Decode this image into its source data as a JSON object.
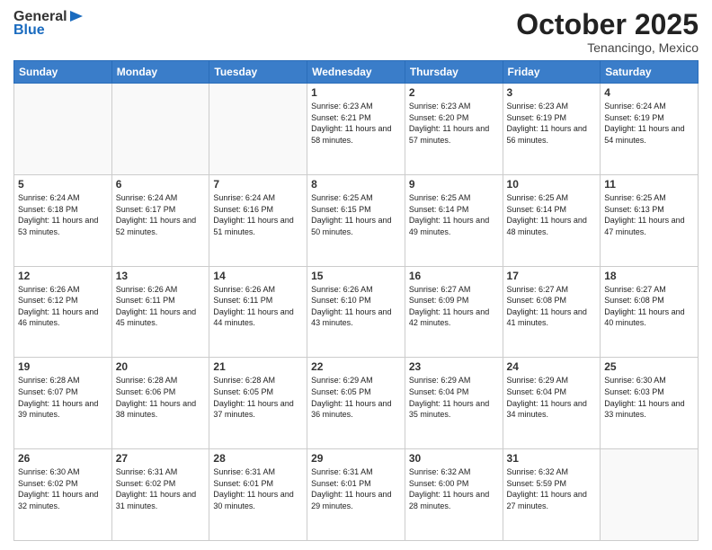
{
  "header": {
    "logo_general": "General",
    "logo_blue": "Blue",
    "month_title": "October 2025",
    "location": "Tenancingo, Mexico"
  },
  "days_of_week": [
    "Sunday",
    "Monday",
    "Tuesday",
    "Wednesday",
    "Thursday",
    "Friday",
    "Saturday"
  ],
  "weeks": [
    [
      {
        "day": "",
        "sunrise": "",
        "sunset": "",
        "daylight": ""
      },
      {
        "day": "",
        "sunrise": "",
        "sunset": "",
        "daylight": ""
      },
      {
        "day": "",
        "sunrise": "",
        "sunset": "",
        "daylight": ""
      },
      {
        "day": "1",
        "sunrise": "Sunrise: 6:23 AM",
        "sunset": "Sunset: 6:21 PM",
        "daylight": "Daylight: 11 hours and 58 minutes."
      },
      {
        "day": "2",
        "sunrise": "Sunrise: 6:23 AM",
        "sunset": "Sunset: 6:20 PM",
        "daylight": "Daylight: 11 hours and 57 minutes."
      },
      {
        "day": "3",
        "sunrise": "Sunrise: 6:23 AM",
        "sunset": "Sunset: 6:19 PM",
        "daylight": "Daylight: 11 hours and 56 minutes."
      },
      {
        "day": "4",
        "sunrise": "Sunrise: 6:24 AM",
        "sunset": "Sunset: 6:19 PM",
        "daylight": "Daylight: 11 hours and 54 minutes."
      }
    ],
    [
      {
        "day": "5",
        "sunrise": "Sunrise: 6:24 AM",
        "sunset": "Sunset: 6:18 PM",
        "daylight": "Daylight: 11 hours and 53 minutes."
      },
      {
        "day": "6",
        "sunrise": "Sunrise: 6:24 AM",
        "sunset": "Sunset: 6:17 PM",
        "daylight": "Daylight: 11 hours and 52 minutes."
      },
      {
        "day": "7",
        "sunrise": "Sunrise: 6:24 AM",
        "sunset": "Sunset: 6:16 PM",
        "daylight": "Daylight: 11 hours and 51 minutes."
      },
      {
        "day": "8",
        "sunrise": "Sunrise: 6:25 AM",
        "sunset": "Sunset: 6:15 PM",
        "daylight": "Daylight: 11 hours and 50 minutes."
      },
      {
        "day": "9",
        "sunrise": "Sunrise: 6:25 AM",
        "sunset": "Sunset: 6:14 PM",
        "daylight": "Daylight: 11 hours and 49 minutes."
      },
      {
        "day": "10",
        "sunrise": "Sunrise: 6:25 AM",
        "sunset": "Sunset: 6:14 PM",
        "daylight": "Daylight: 11 hours and 48 minutes."
      },
      {
        "day": "11",
        "sunrise": "Sunrise: 6:25 AM",
        "sunset": "Sunset: 6:13 PM",
        "daylight": "Daylight: 11 hours and 47 minutes."
      }
    ],
    [
      {
        "day": "12",
        "sunrise": "Sunrise: 6:26 AM",
        "sunset": "Sunset: 6:12 PM",
        "daylight": "Daylight: 11 hours and 46 minutes."
      },
      {
        "day": "13",
        "sunrise": "Sunrise: 6:26 AM",
        "sunset": "Sunset: 6:11 PM",
        "daylight": "Daylight: 11 hours and 45 minutes."
      },
      {
        "day": "14",
        "sunrise": "Sunrise: 6:26 AM",
        "sunset": "Sunset: 6:11 PM",
        "daylight": "Daylight: 11 hours and 44 minutes."
      },
      {
        "day": "15",
        "sunrise": "Sunrise: 6:26 AM",
        "sunset": "Sunset: 6:10 PM",
        "daylight": "Daylight: 11 hours and 43 minutes."
      },
      {
        "day": "16",
        "sunrise": "Sunrise: 6:27 AM",
        "sunset": "Sunset: 6:09 PM",
        "daylight": "Daylight: 11 hours and 42 minutes."
      },
      {
        "day": "17",
        "sunrise": "Sunrise: 6:27 AM",
        "sunset": "Sunset: 6:08 PM",
        "daylight": "Daylight: 11 hours and 41 minutes."
      },
      {
        "day": "18",
        "sunrise": "Sunrise: 6:27 AM",
        "sunset": "Sunset: 6:08 PM",
        "daylight": "Daylight: 11 hours and 40 minutes."
      }
    ],
    [
      {
        "day": "19",
        "sunrise": "Sunrise: 6:28 AM",
        "sunset": "Sunset: 6:07 PM",
        "daylight": "Daylight: 11 hours and 39 minutes."
      },
      {
        "day": "20",
        "sunrise": "Sunrise: 6:28 AM",
        "sunset": "Sunset: 6:06 PM",
        "daylight": "Daylight: 11 hours and 38 minutes."
      },
      {
        "day": "21",
        "sunrise": "Sunrise: 6:28 AM",
        "sunset": "Sunset: 6:05 PM",
        "daylight": "Daylight: 11 hours and 37 minutes."
      },
      {
        "day": "22",
        "sunrise": "Sunrise: 6:29 AM",
        "sunset": "Sunset: 6:05 PM",
        "daylight": "Daylight: 11 hours and 36 minutes."
      },
      {
        "day": "23",
        "sunrise": "Sunrise: 6:29 AM",
        "sunset": "Sunset: 6:04 PM",
        "daylight": "Daylight: 11 hours and 35 minutes."
      },
      {
        "day": "24",
        "sunrise": "Sunrise: 6:29 AM",
        "sunset": "Sunset: 6:04 PM",
        "daylight": "Daylight: 11 hours and 34 minutes."
      },
      {
        "day": "25",
        "sunrise": "Sunrise: 6:30 AM",
        "sunset": "Sunset: 6:03 PM",
        "daylight": "Daylight: 11 hours and 33 minutes."
      }
    ],
    [
      {
        "day": "26",
        "sunrise": "Sunrise: 6:30 AM",
        "sunset": "Sunset: 6:02 PM",
        "daylight": "Daylight: 11 hours and 32 minutes."
      },
      {
        "day": "27",
        "sunrise": "Sunrise: 6:31 AM",
        "sunset": "Sunset: 6:02 PM",
        "daylight": "Daylight: 11 hours and 31 minutes."
      },
      {
        "day": "28",
        "sunrise": "Sunrise: 6:31 AM",
        "sunset": "Sunset: 6:01 PM",
        "daylight": "Daylight: 11 hours and 30 minutes."
      },
      {
        "day": "29",
        "sunrise": "Sunrise: 6:31 AM",
        "sunset": "Sunset: 6:01 PM",
        "daylight": "Daylight: 11 hours and 29 minutes."
      },
      {
        "day": "30",
        "sunrise": "Sunrise: 6:32 AM",
        "sunset": "Sunset: 6:00 PM",
        "daylight": "Daylight: 11 hours and 28 minutes."
      },
      {
        "day": "31",
        "sunrise": "Sunrise: 6:32 AM",
        "sunset": "Sunset: 5:59 PM",
        "daylight": "Daylight: 11 hours and 27 minutes."
      },
      {
        "day": "",
        "sunrise": "",
        "sunset": "",
        "daylight": ""
      }
    ]
  ]
}
